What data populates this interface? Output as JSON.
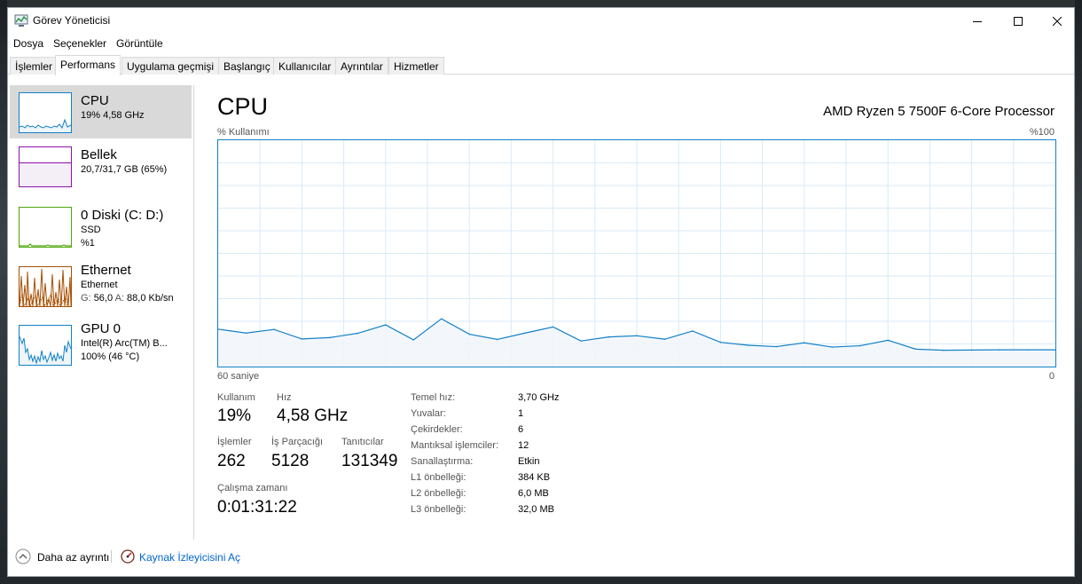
{
  "window": {
    "title": "Görev Yöneticisi",
    "icon": "task-manager-icon",
    "controls": [
      "minimize-icon",
      "maximize-icon",
      "close-icon"
    ]
  },
  "menu": [
    "Dosya",
    "Seçenekler",
    "Görüntüle"
  ],
  "tabs": [
    "İşlemler",
    "Performans",
    "Uygulama geçmişi",
    "Başlangıç",
    "Kullanıcılar",
    "Ayrıntılar",
    "Hizmetler"
  ],
  "active_tab": "Performans",
  "sidebar": {
    "cpu": {
      "title": "CPU",
      "detail": "19% 4,58 GHz"
    },
    "memory": {
      "title": "Bellek",
      "detail": "20,7/31,7 GB (65%)",
      "used_fraction": 0.65
    },
    "disk": {
      "title": "0 Diski (C: D:)",
      "type": "SSD",
      "detail": "%1"
    },
    "ethernet": {
      "title": "Ethernet",
      "name": "Ethernet",
      "recv_label": "G:",
      "recv_value": "56,0",
      "send_label": "A:",
      "send_value": "88,0 Kb/sn"
    },
    "gpu": {
      "title": "GPU 0",
      "name": "Intel(R) Arc(TM) B...",
      "detail": "100% (46 °C)"
    }
  },
  "main": {
    "title": "CPU",
    "processor": "AMD Ryzen 5 7500F 6-Core Processor",
    "y_label": "% Kullanımı",
    "y_max": "%100",
    "x_left": "60 saniye",
    "x_right": "0"
  },
  "chart_data": {
    "type": "area",
    "x": [
      60,
      58,
      56,
      54,
      52,
      50,
      48,
      46,
      44,
      42,
      40,
      38,
      36,
      34,
      32,
      30,
      28,
      26,
      24,
      22,
      20,
      18,
      16,
      14,
      12,
      10,
      8,
      6,
      4,
      2,
      0
    ],
    "values": [
      16.5,
      14.8,
      16.4,
      12.2,
      12.8,
      14.7,
      18.4,
      11.8,
      21.1,
      14.3,
      12,
      14.8,
      17.5,
      11.3,
      13.1,
      13.6,
      12.1,
      15.7,
      10.7,
      9.4,
      8.8,
      10.5,
      8.6,
      9.2,
      11.6,
      7.7,
      7.2,
      7.3,
      7.4,
      7.4,
      7.4
    ],
    "xlim": [
      60,
      0
    ],
    "ylim": [
      0,
      100
    ],
    "grid": true,
    "line_color": "#1280c8",
    "fill_color": "#f1f6fa"
  },
  "stats": {
    "usage_label": "Kullanım",
    "usage_value": "19%",
    "speed_label": "Hız",
    "speed_value": "4,58 GHz",
    "processes_label": "İşlemler",
    "processes_value": "262",
    "threads_label": "İş Parçacığı",
    "threads_value": "5128",
    "handles_label": "Tanıtıcılar",
    "handles_value": "131349",
    "uptime_label": "Çalışma zamanı",
    "uptime_value": "0:01:31:22"
  },
  "specs": [
    {
      "label": "Temel hız:",
      "value": "3,70 GHz"
    },
    {
      "label": "Yuvalar:",
      "value": "1"
    },
    {
      "label": "Çekirdekler:",
      "value": "6"
    },
    {
      "label": "Mantıksal işlemciler:",
      "value": "12"
    },
    {
      "label": "Sanallaştırma:",
      "value": "Etkin"
    },
    {
      "label": "L1 önbelleği:",
      "value": "384 KB"
    },
    {
      "label": "L2 önbelleği:",
      "value": "6,0 MB"
    },
    {
      "label": "L3 önbelleği:",
      "value": "32,0 MB"
    }
  ],
  "footer": {
    "fewer_details": "Daha az ayrıntı",
    "resource_monitor": "Kaynak İzleyicisini Aç"
  },
  "colors": {
    "cpu": "#1280c8",
    "memory": "#8b12ae",
    "disk": "#4da60c",
    "ethernet": "#a74f01",
    "gpu": "#1280c8"
  }
}
